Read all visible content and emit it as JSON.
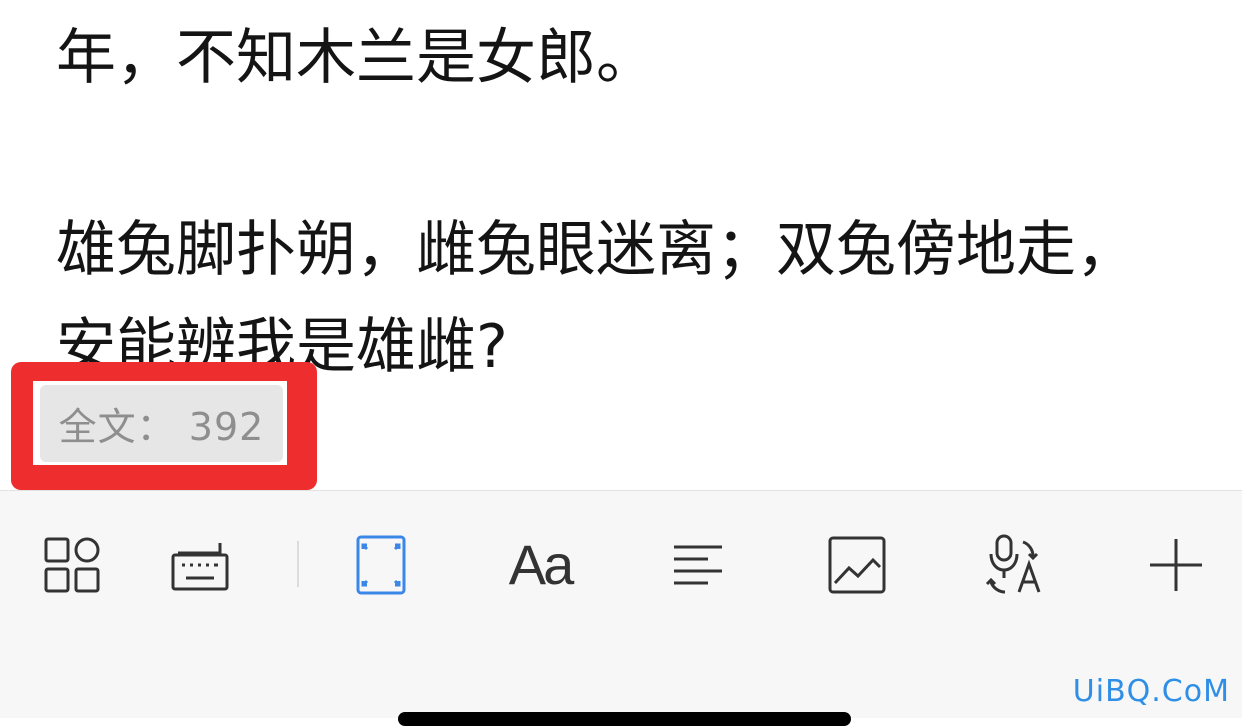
{
  "document": {
    "lines": [
      "年，不知木兰是女郎。",
      "雄兔脚扑朔，雌兔眼迷离；双兔傍地走，",
      "安能辨我是雄雌?"
    ]
  },
  "word_count": {
    "label": "全文：",
    "value": "392"
  },
  "toolbar": {
    "tools": [
      {
        "icon": "grid-icon",
        "name": "toolbar-grid-button"
      },
      {
        "icon": "keyboard-icon",
        "name": "toolbar-keyboard-button"
      },
      {
        "icon": "fullscreen-frame-icon",
        "name": "toolbar-frame-button",
        "active": true
      },
      {
        "icon": "font-style-icon",
        "name": "toolbar-font-button",
        "glyph": "Aa"
      },
      {
        "icon": "align-left-icon",
        "name": "toolbar-align-button"
      },
      {
        "icon": "image-icon",
        "name": "toolbar-image-button"
      },
      {
        "icon": "voice-translate-icon",
        "name": "toolbar-voice-button"
      },
      {
        "icon": "plus-icon",
        "name": "toolbar-add-button"
      }
    ],
    "active_color": "#3b87e8",
    "icon_color": "#333333"
  },
  "annotation": {
    "highlight_color": "#ee2e2e"
  },
  "watermark": "UiBQ.CoM"
}
